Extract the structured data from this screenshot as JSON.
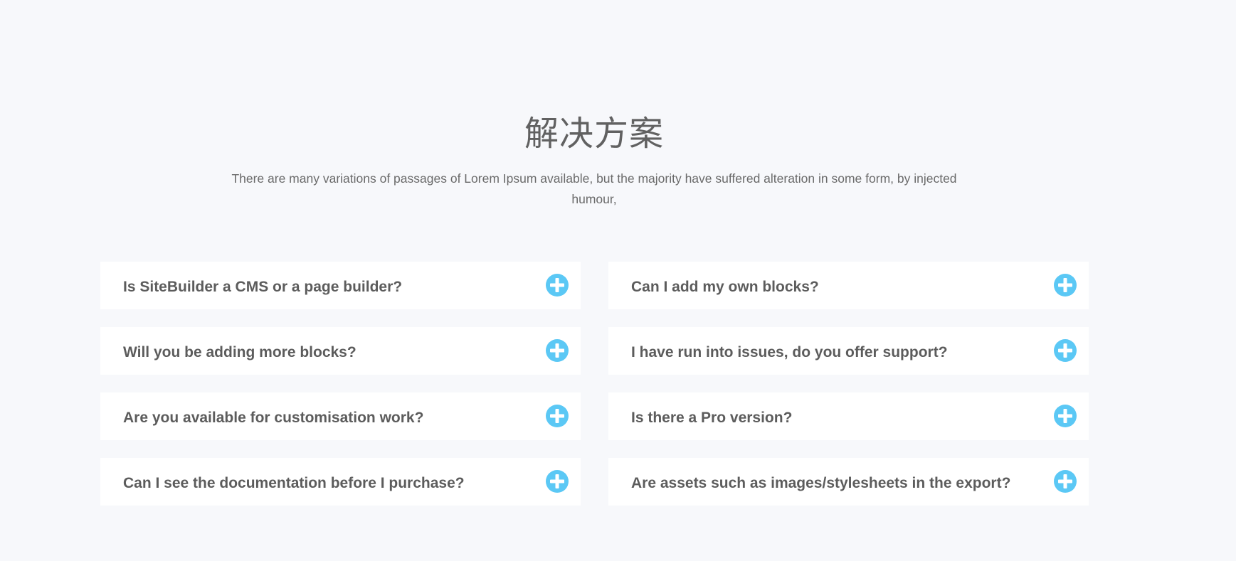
{
  "section": {
    "title": "解决方案",
    "subtitle": "There are many variations of passages of Lorem Ipsum available, but the majority have suffered alteration in some form, by injected humour,"
  },
  "faq": {
    "items": [
      {
        "question": "Is SiteBuilder a CMS or a page builder?",
        "icon": "plus-circle-icon"
      },
      {
        "question": "Can I add my own blocks?",
        "icon": "plus-circle-icon"
      },
      {
        "question": "Will you be adding more blocks?",
        "icon": "plus-circle-icon"
      },
      {
        "question": "I have run into issues, do you offer support?",
        "icon": "plus-circle-icon"
      },
      {
        "question": "Are you available for customisation work?",
        "icon": "plus-circle-icon"
      },
      {
        "question": "Is there a Pro version?",
        "icon": "plus-circle-icon"
      },
      {
        "question": "Can I see the documentation before I purchase?",
        "icon": "plus-circle-icon"
      },
      {
        "question": "Are assets such as images/stylesheets in the export?",
        "icon": "plus-circle-icon"
      }
    ]
  },
  "colors": {
    "background": "#f7f8fb",
    "card": "#ffffff",
    "accent": "#5bc8f5",
    "text": "#5c5c5c"
  }
}
